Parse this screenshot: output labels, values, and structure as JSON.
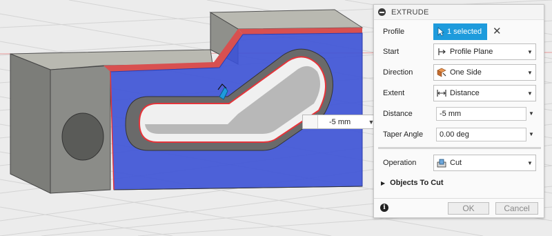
{
  "viewport": {
    "distance_value": "-5 mm",
    "grid_color": "#d4d4d4",
    "body_color": "#8a8a8a",
    "profile_color": "#3a4fd6",
    "edge_color": "#e5343a"
  },
  "panel": {
    "title": "EXTRUDE",
    "profile": {
      "label": "Profile",
      "button": "1 selected",
      "icon": "cursor-icon"
    },
    "start": {
      "label": "Start",
      "value": "Profile Plane",
      "icon": "profile-plane-icon"
    },
    "direction": {
      "label": "Direction",
      "value": "One Side",
      "icon": "one-side-icon"
    },
    "extent": {
      "label": "Extent",
      "value": "Distance",
      "icon": "distance-icon"
    },
    "distance": {
      "label": "Distance",
      "value": "-5 mm"
    },
    "taper": {
      "label": "Taper Angle",
      "value": "0.00 deg"
    },
    "operation": {
      "label": "Operation",
      "value": "Cut",
      "icon": "cut-icon"
    },
    "objects_to_cut": "Objects To Cut",
    "ok": "OK",
    "cancel": "Cancel",
    "accent_color": "#1e9bdc"
  }
}
